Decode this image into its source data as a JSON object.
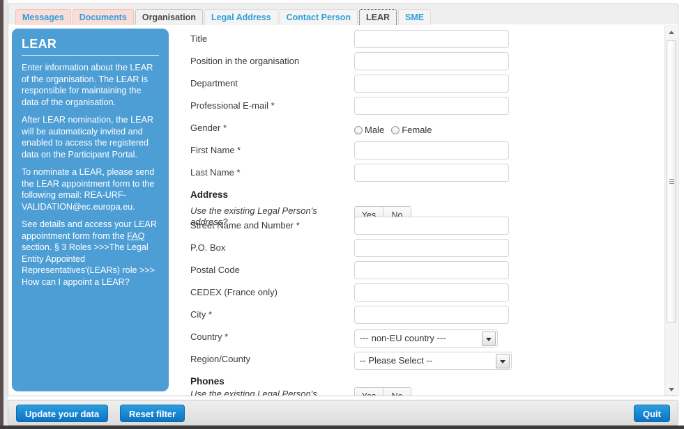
{
  "tabs": [
    {
      "label": "Messages",
      "style": "pink",
      "active": false
    },
    {
      "label": "Documents",
      "style": "pink",
      "active": false
    },
    {
      "label": "Organisation",
      "style": "plain",
      "active": false
    },
    {
      "label": "Legal Address",
      "style": "link",
      "active": false
    },
    {
      "label": "Contact Person",
      "style": "link",
      "active": false
    },
    {
      "label": "LEAR",
      "style": "active",
      "active": true
    },
    {
      "label": "SME",
      "style": "link",
      "active": false
    }
  ],
  "info_panel": {
    "title": "LEAR",
    "paragraphs": [
      "Enter information about the LEAR of the organisation. The LEAR is responsible for maintaining the data of the organisation.",
      "After LEAR nomination, the LEAR will be automaticaly invited and enabled to access the registered data on the Participant Portal.",
      "To nominate a LEAR, please send the LEAR appointment form to the following email: REA-URF-VALIDATION@ec.europa.eu."
    ],
    "last_paragraph_part1": "See details and access your LEAR appointment form from the ",
    "last_paragraph_link": "FAQ",
    "last_paragraph_part2": " section. § 3 Roles >>>The Legal Entity Appointed Representatives'(LEARs) role >>> How can I appoint a LEAR?"
  },
  "form": {
    "fields": [
      {
        "label": "Title",
        "type": "text",
        "value": ""
      },
      {
        "label": "Position in the organisation",
        "type": "text",
        "value": ""
      },
      {
        "label": "Department",
        "type": "text",
        "value": ""
      },
      {
        "label": "Professional E-mail *",
        "type": "text",
        "value": ""
      }
    ],
    "gender": {
      "label": "Gender *",
      "options": [
        "Male",
        "Female"
      ],
      "selected": ""
    },
    "name_fields": [
      {
        "label": "First Name *",
        "type": "text",
        "value": ""
      },
      {
        "label": "Last Name *",
        "type": "text",
        "value": ""
      }
    ],
    "address_section": {
      "heading": "Address",
      "use_existing_label": "Use the existing Legal Person's address?",
      "yes_label": "Yes",
      "no_label": "No",
      "fields": [
        {
          "label": "Street Name and Number *",
          "type": "text",
          "value": ""
        },
        {
          "label": "P.O. Box",
          "type": "text",
          "value": ""
        },
        {
          "label": "Postal Code",
          "type": "text",
          "value": ""
        },
        {
          "label": "CEDEX (France only)",
          "type": "text",
          "value": ""
        },
        {
          "label": "City *",
          "type": "text",
          "value": ""
        }
      ],
      "country": {
        "label": "Country *",
        "selected": "--- non-EU country ---"
      },
      "region": {
        "label": "Region/County",
        "selected": "-- Please Select --"
      }
    },
    "phones_section": {
      "heading": "Phones",
      "use_existing_label": "Use the existing Legal Person's",
      "yes_label": "Yes",
      "no_label": "No"
    }
  },
  "actionbar": {
    "update_label": "Update your data",
    "reset_label": "Reset filter",
    "quit_label": "Quit"
  },
  "colors": {
    "panel_blue": "#4e9ed6",
    "tab_link": "#2f9fd8",
    "tab_pink": "#fadcd8",
    "button_blue": "#0d72c2"
  }
}
